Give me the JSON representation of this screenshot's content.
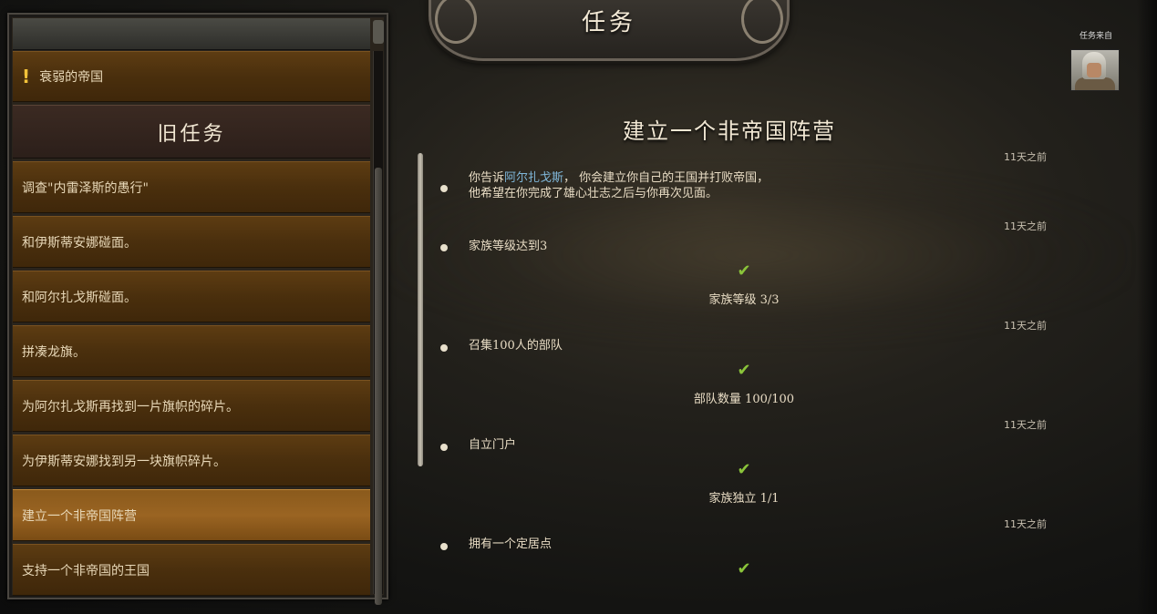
{
  "header": {
    "title": "任务"
  },
  "giver": {
    "label": "任务来自"
  },
  "quest_list": {
    "active": [
      {
        "label": "衰弱的帝国",
        "icon": "exclamation-icon"
      }
    ],
    "old_header": "旧任务",
    "old": [
      {
        "label": "调查\"内雷泽斯的愚行\""
      },
      {
        "label": "和伊斯蒂安娜碰面。"
      },
      {
        "label": "和阿尔扎戈斯碰面。"
      },
      {
        "label": "拼凑龙旗。"
      },
      {
        "label": "为阿尔扎戈斯再找到一片旗帜的碎片。"
      },
      {
        "label": "为伊斯蒂安娜找到另一块旗帜碎片。"
      },
      {
        "label": "建立一个非帝国阵营",
        "selected": true
      },
      {
        "label": "支持一个非帝国的王国"
      }
    ]
  },
  "detail": {
    "title": "建立一个非帝国阵营",
    "entries": [
      {
        "time": "11天之前",
        "text_pre": "你告诉",
        "text_highlight": "阿尔扎戈斯",
        "text_post": "， 你会建立你自己的王国并打败帝国，",
        "text_line2": "他希望在你完成了雄心壮志之后与你再次见面。"
      },
      {
        "time": "11天之前",
        "text": "家族等级达到3",
        "progress": "家族等级  3/3",
        "check": "✔"
      },
      {
        "time": "11天之前",
        "text": "召集100人的部队",
        "progress": "部队数量  100/100",
        "check": "✔"
      },
      {
        "time": "11天之前",
        "text": "自立门户",
        "progress": "家族独立  1/1",
        "check": "✔"
      },
      {
        "time": "11天之前",
        "text": "拥有一个定居点",
        "check": "✔"
      }
    ]
  },
  "colors": {
    "accent_check": "#8ac43a",
    "highlight_name": "#7fb6d8",
    "selected_item": "#9a6422",
    "item_bg": "#4a2f0d"
  }
}
